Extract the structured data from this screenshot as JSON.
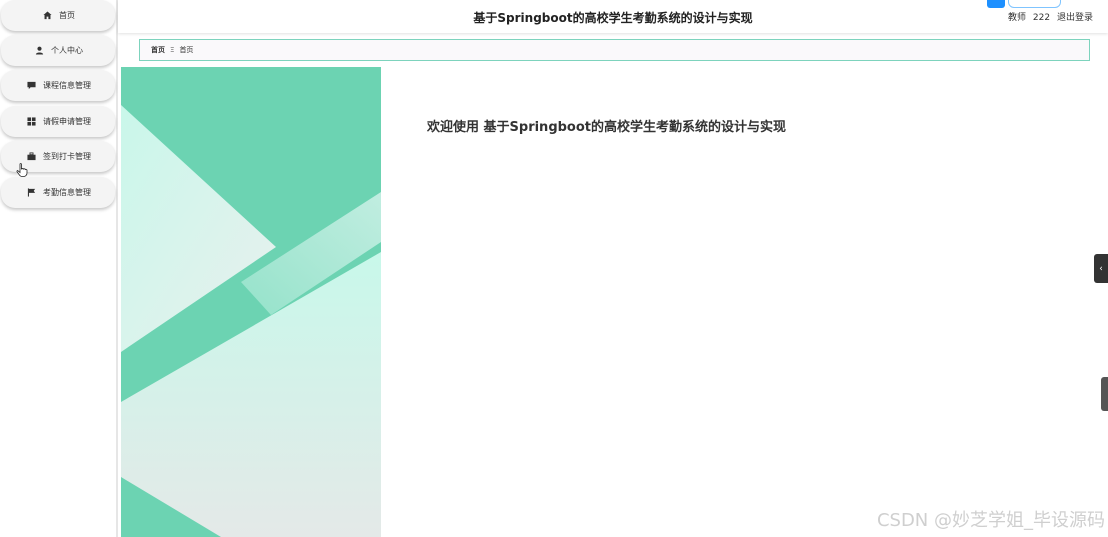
{
  "app": {
    "title": "基于Springboot的高校学生考勤系统的设计与实现",
    "welcome": "欢迎使用 基于Springboot的高校学生考勤系统的设计与实现"
  },
  "sidebar": {
    "items": [
      {
        "label": "首页",
        "icon": "home-icon"
      },
      {
        "label": "个人中心",
        "icon": "user-icon"
      },
      {
        "label": "课程信息管理",
        "icon": "chat-icon"
      },
      {
        "label": "请假申请管理",
        "icon": "grid-icon"
      },
      {
        "label": "签到打卡管理",
        "icon": "briefcase-icon"
      },
      {
        "label": "考勤信息管理",
        "icon": "flag-icon"
      }
    ]
  },
  "header": {
    "role": "教师",
    "username": "222",
    "logout": "退出登录"
  },
  "breadcrumb": {
    "home": "首页",
    "separator": "Ξ",
    "current": "首页"
  },
  "side_tab": {
    "label": "‹"
  },
  "watermark": "CSDN @妙芝学姐_毕设源码",
  "colors": {
    "banner_green": "#6cd3b2",
    "breadcrumb_border": "#7dd3bd",
    "login_badge": "#1e90ff"
  }
}
